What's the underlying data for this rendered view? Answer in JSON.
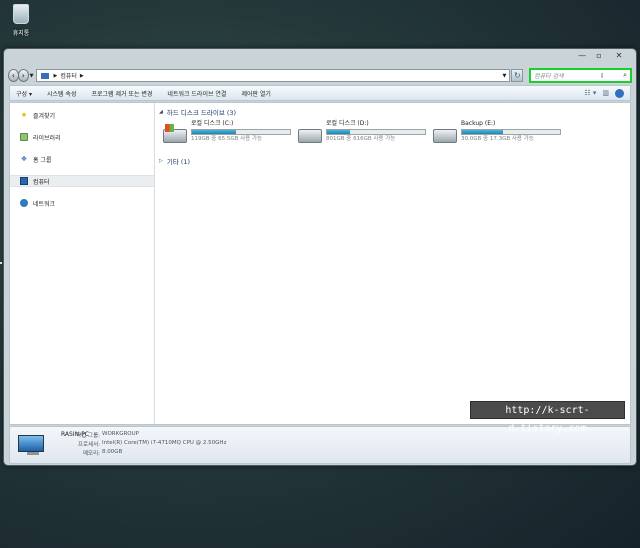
{
  "desktop": {
    "recycle_bin_label": "휴지통"
  },
  "window": {
    "controls": {
      "minimize": "—",
      "maximize": "▫",
      "close": "✕"
    },
    "address": {
      "crumbs": [
        "컴퓨터"
      ],
      "search_placeholder": "컴퓨터 검색"
    },
    "toolbar": {
      "organize": "구성 ▾",
      "system_properties": "시스템 속성",
      "uninstall": "프로그램 제거 또는 변경",
      "map_drive": "네트워크 드라이브 연결",
      "control_panel": "제어판 열기"
    },
    "nav": [
      {
        "label": "즐겨찾기",
        "icon": "star-icon"
      },
      {
        "label": "라이브러리",
        "icon": "library-icon"
      },
      {
        "label": "홈 그룹",
        "icon": "homegroup-icon"
      },
      {
        "label": "컴퓨터",
        "icon": "computer-icon",
        "selected": true
      },
      {
        "label": "네트워크",
        "icon": "network-icon"
      }
    ],
    "hdd_group": "하드 디스크 드라이브 (3)",
    "drives": [
      {
        "name": "로컬 디스크 (C:)",
        "free": "119GB 중 65.5GB 사용 가능",
        "used_fraction": 0.45
      },
      {
        "name": "로컬 디스크 (D:)",
        "free": "801GB 중 616GB 사용 가능",
        "used_fraction": 0.23
      },
      {
        "name": "Backup (E:)",
        "free": "30.0GB 중 17.3GB 사용 가능",
        "used_fraction": 0.42
      }
    ],
    "other_group": "기타 (1)",
    "details": {
      "pc_name": "RASIN-PC",
      "workgroup_label": "작업 그룹:",
      "workgroup_value": "WORKGROUP",
      "processor_label": "프로세서:",
      "processor_value": "Intel(R) Core(TM) i7-4710MQ CPU @ 2.50GHz",
      "memory_label": "메모리:",
      "memory_value": "8.00GB"
    }
  },
  "watermark": "http://k-scrt-d.tistory.com"
}
